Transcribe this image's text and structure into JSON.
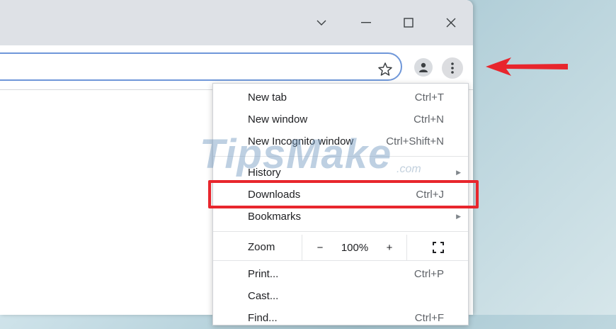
{
  "window_controls": {
    "tab_search": "⌄",
    "minimize": "—",
    "maximize": "☐",
    "close": "✕"
  },
  "toolbar": {
    "bookmark_icon": "star-icon",
    "profile_icon": "profile-icon",
    "menu_icon": "more-vert-icon"
  },
  "menu": {
    "items": [
      {
        "label": "New tab",
        "shortcut": "Ctrl+T"
      },
      {
        "label": "New window",
        "shortcut": "Ctrl+N"
      },
      {
        "label": "New Incognito window",
        "shortcut": "Ctrl+Shift+N"
      },
      {
        "label": "History",
        "shortcut": ""
      },
      {
        "label": "Downloads",
        "shortcut": "Ctrl+J"
      },
      {
        "label": "Bookmarks",
        "shortcut": ""
      }
    ],
    "zoom": {
      "label": "Zoom",
      "minus": "−",
      "value": "100%",
      "plus": "+"
    },
    "items2": [
      {
        "label": "Print...",
        "shortcut": "Ctrl+P"
      },
      {
        "label": "Cast...",
        "shortcut": ""
      },
      {
        "label": "Find...",
        "shortcut": "Ctrl+F"
      }
    ]
  },
  "watermark": {
    "main": "TipsMake",
    "suffix": ".com"
  },
  "colors": {
    "highlight": "#e8262d",
    "arrow": "#e8262d",
    "omnibox_border": "#6f97d9"
  }
}
